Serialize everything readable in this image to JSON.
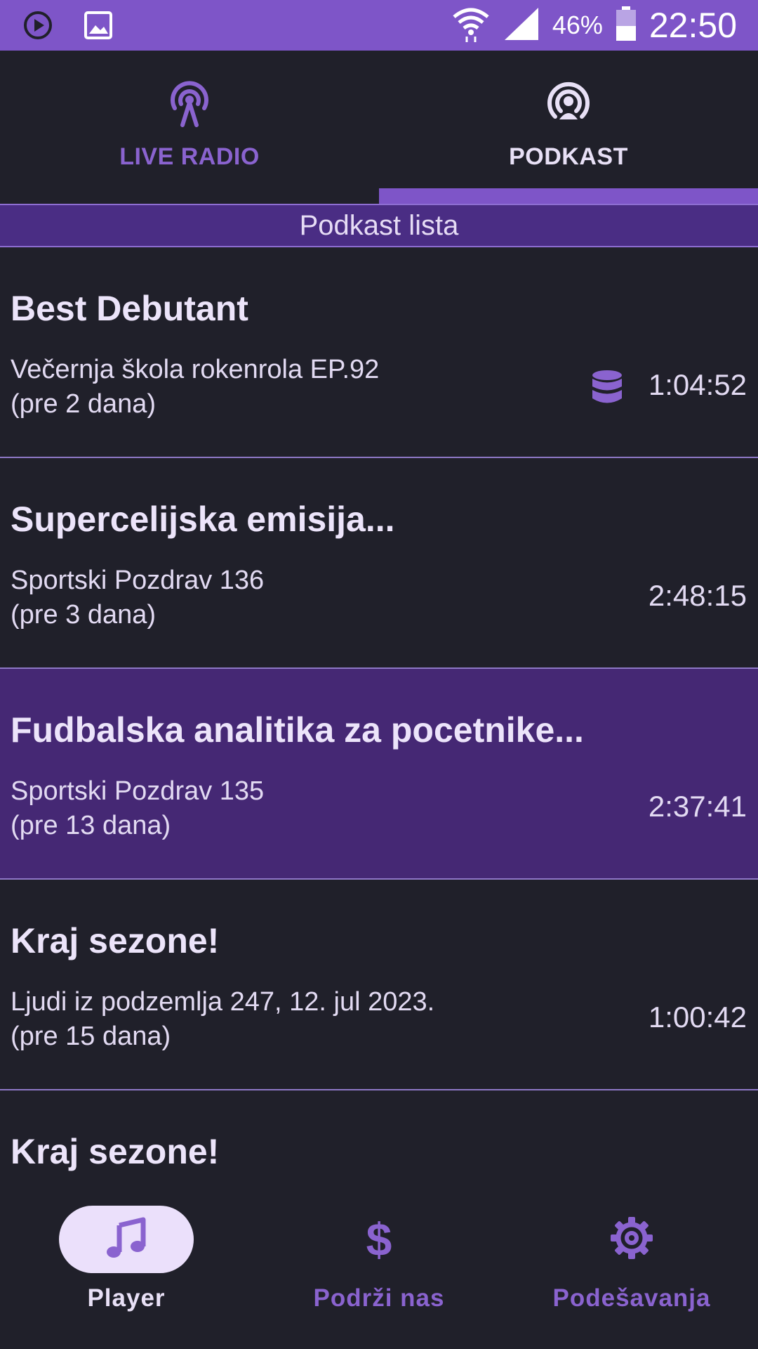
{
  "status_bar": {
    "battery_percent": "46%",
    "time": "22:50",
    "battery_level": 0.46,
    "icons": [
      "play-circle-icon",
      "image-icon",
      "wifi-icon",
      "signal-icon",
      "battery-icon"
    ]
  },
  "tabs": [
    {
      "label": "LIVE RADIO",
      "icon": "radio-tower-icon",
      "active": false
    },
    {
      "label": "PODKAST",
      "icon": "podcast-icon",
      "active": true
    }
  ],
  "list_header": "Podkast lista",
  "podcasts": [
    {
      "title": "Best Debutant",
      "subtitle": "Večernja škola rokenrola EP.92",
      "age": "(pre 2 dana)",
      "duration": "1:04:52",
      "downloaded": true,
      "selected": false
    },
    {
      "title": "Supercelijska emisija...",
      "subtitle": "Sportski Pozdrav 136",
      "age": "(pre 3 dana)",
      "duration": "2:48:15",
      "downloaded": false,
      "selected": false
    },
    {
      "title": "Fudbalska analitika za pocetnike...",
      "subtitle": "Sportski Pozdrav 135",
      "age": "(pre 13 dana)",
      "duration": "2:37:41",
      "downloaded": false,
      "selected": true
    },
    {
      "title": "Kraj sezone!",
      "subtitle": "Ljudi iz podzemlja 247, 12. jul 2023.",
      "age": "(pre 15 dana)",
      "duration": "1:00:42",
      "downloaded": false,
      "selected": false
    },
    {
      "title": "Kraj sezone!",
      "subtitle": "",
      "age": "",
      "duration": "",
      "downloaded": false,
      "selected": false
    }
  ],
  "bottom_nav": [
    {
      "label": "Player",
      "icon": "music-note-icon",
      "active": true
    },
    {
      "label": "Podrži nas",
      "icon": "dollar-icon",
      "active": false
    },
    {
      "label": "Podešavanja",
      "icon": "gear-icon",
      "active": false
    }
  ],
  "colors": {
    "accent": "#7e55c8",
    "background": "#20202a",
    "selected_row": "#452874",
    "header": "#4a2d84"
  }
}
